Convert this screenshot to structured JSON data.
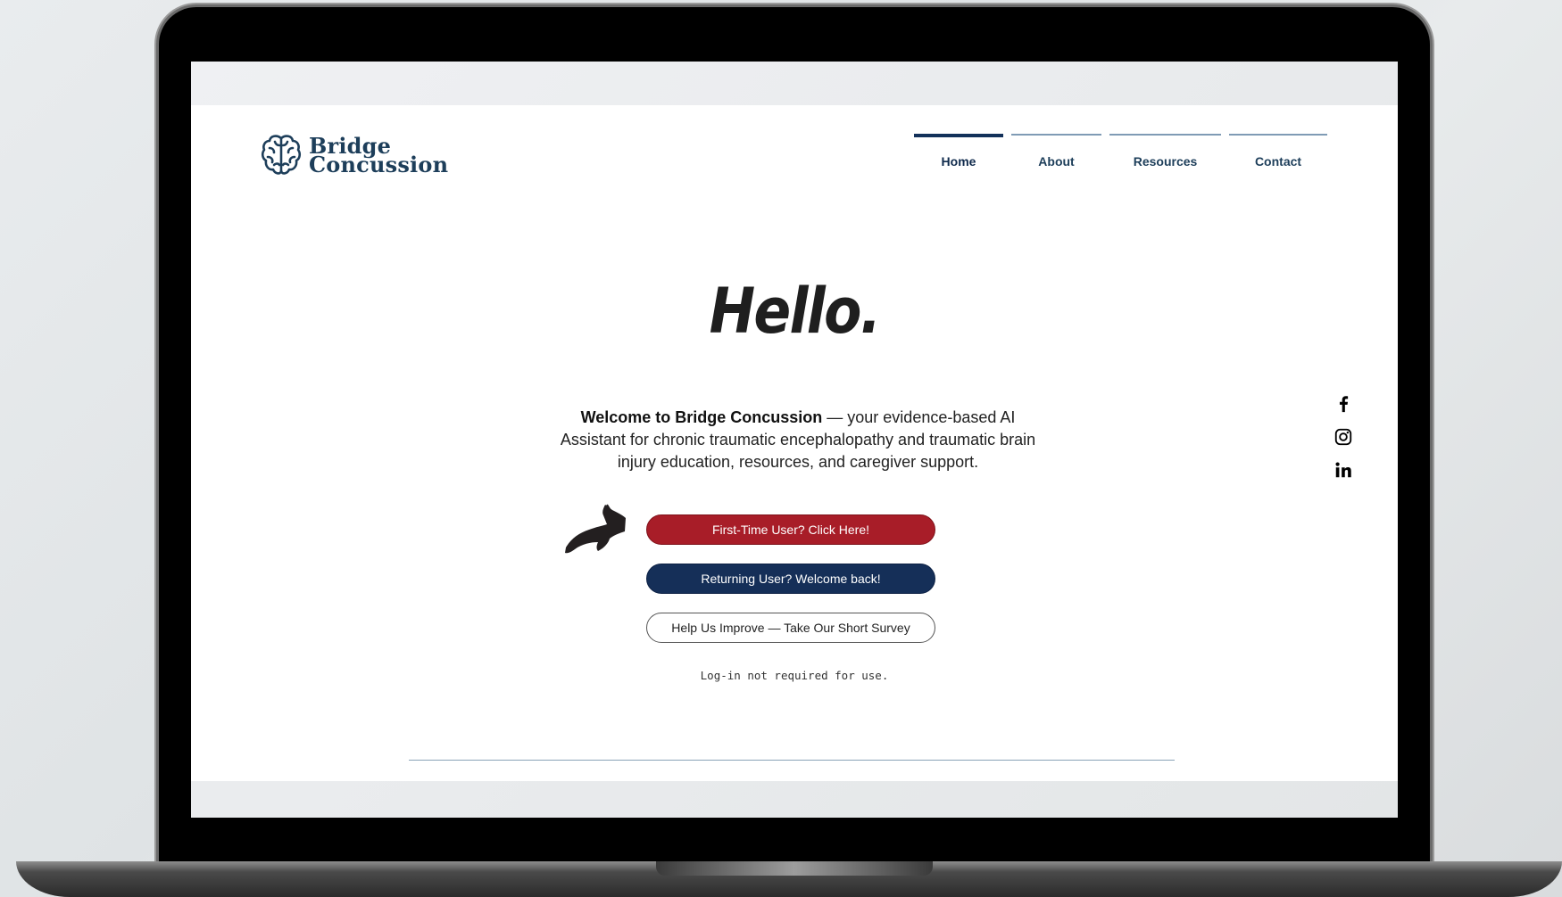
{
  "brand": {
    "line1": "Bridge",
    "line2": "Concussion",
    "color": "#1d3e5a"
  },
  "nav": {
    "items": [
      {
        "label": "Home",
        "active": true
      },
      {
        "label": "About",
        "active": false
      },
      {
        "label": "Resources",
        "active": false
      },
      {
        "label": "Contact",
        "active": false
      }
    ]
  },
  "hero": {
    "heading": "Hello.",
    "welcome_bold": "Welcome to Bridge Concussion",
    "welcome_rest": " — your evidence-based AI Assistant for chronic traumatic encephalopathy and traumatic brain injury education, resources, and caregiver support."
  },
  "buttons": {
    "first_time": "First-Time User? Click Here!",
    "returning": "Returning User? Welcome back!",
    "survey": "Help Us Improve — Take Our Short Survey"
  },
  "note": "Log-in not required for use.",
  "social": [
    "facebook-icon",
    "instagram-icon",
    "linkedin-icon"
  ],
  "colors": {
    "red": "#a81d28",
    "navy": "#152f58",
    "nav_active": "#13315a",
    "nav_inactive": "#7f9bb5"
  }
}
